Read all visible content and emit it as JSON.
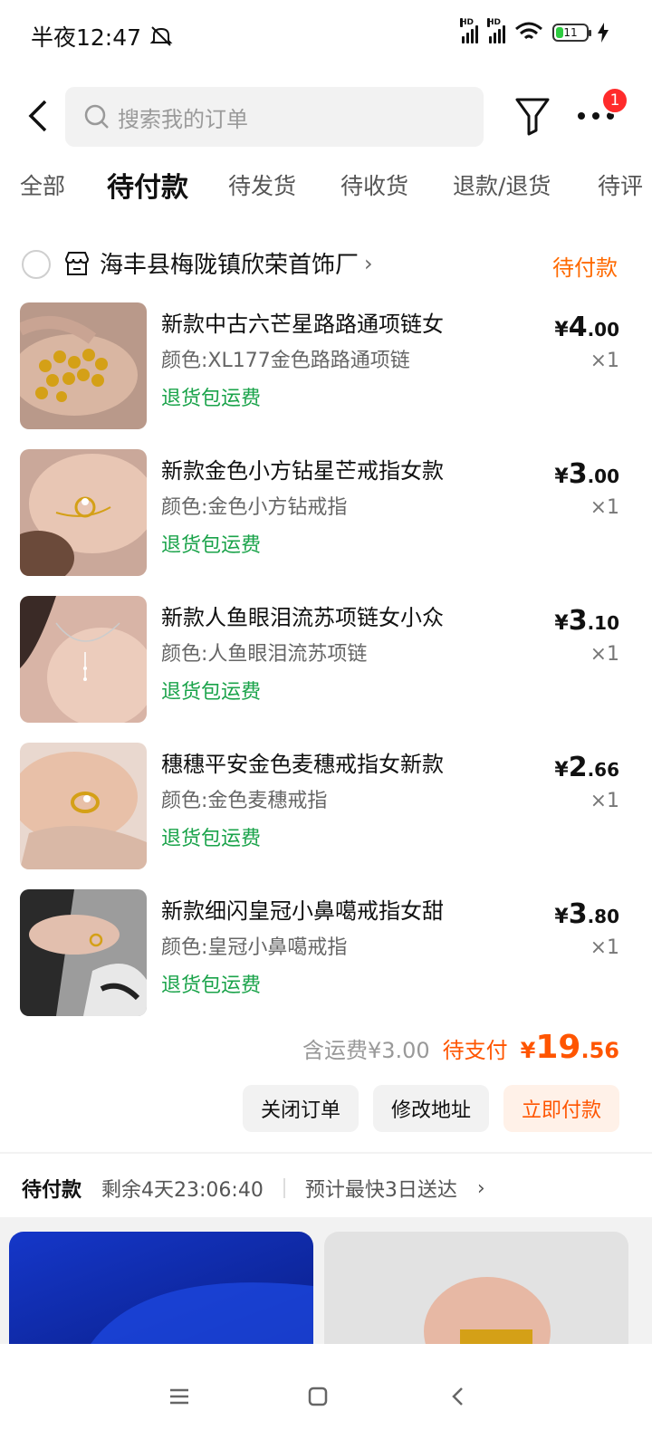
{
  "status_bar": {
    "time": "半夜12:47",
    "battery": "11"
  },
  "header": {
    "search_placeholder": "搜索我的订单",
    "more_badge": "1"
  },
  "tabs": [
    "全部",
    "待付款",
    "待发货",
    "待收货",
    "退款/退货",
    "待评"
  ],
  "order": {
    "shop_name": "海丰县梅陇镇欣荣首饰厂",
    "status": "待付款",
    "items": [
      {
        "title": "新款中古六芒星路路通项链女",
        "sku": "颜色:XL177金色路路通项链",
        "tag": "退货包运费",
        "price_cur": "¥",
        "price_int": "4",
        "price_dec": ".00",
        "qty": "×1"
      },
      {
        "title": "新款金色小方钻星芒戒指女款",
        "sku": "颜色:金色小方钻戒指",
        "tag": "退货包运费",
        "price_cur": "¥",
        "price_int": "3",
        "price_dec": ".00",
        "qty": "×1"
      },
      {
        "title": "新款人鱼眼泪流苏项链女小众",
        "sku": "颜色:人鱼眼泪流苏项链",
        "tag": "退货包运费",
        "price_cur": "¥",
        "price_int": "3",
        "price_dec": ".10",
        "qty": "×1"
      },
      {
        "title": "穗穗平安金色麦穗戒指女新款",
        "sku": "颜色:金色麦穗戒指",
        "tag": "退货包运费",
        "price_cur": "¥",
        "price_int": "2",
        "price_dec": ".66",
        "qty": "×1"
      },
      {
        "title": "新款细闪皇冠小鼻噶戒指女甜",
        "sku": "颜色:皇冠小鼻噶戒指",
        "tag": "退货包运费",
        "price_cur": "¥",
        "price_int": "3",
        "price_dec": ".80",
        "qty": "×1"
      }
    ],
    "shipping_fee": "含运费¥3.00",
    "due_label": "待支付",
    "due_cur": "¥",
    "due_int": "19",
    "due_dec": ".56",
    "buttons": {
      "close": "关闭订单",
      "edit_address": "修改地址",
      "pay_now": "立即付款"
    }
  },
  "next_order": {
    "status": "待付款",
    "countdown": "剩余4天23:06:40",
    "eta": "预计最快3日送达"
  },
  "colors": {
    "accent": "#ff5500",
    "green": "#1aa34a",
    "badge": "#ff2b2b"
  }
}
